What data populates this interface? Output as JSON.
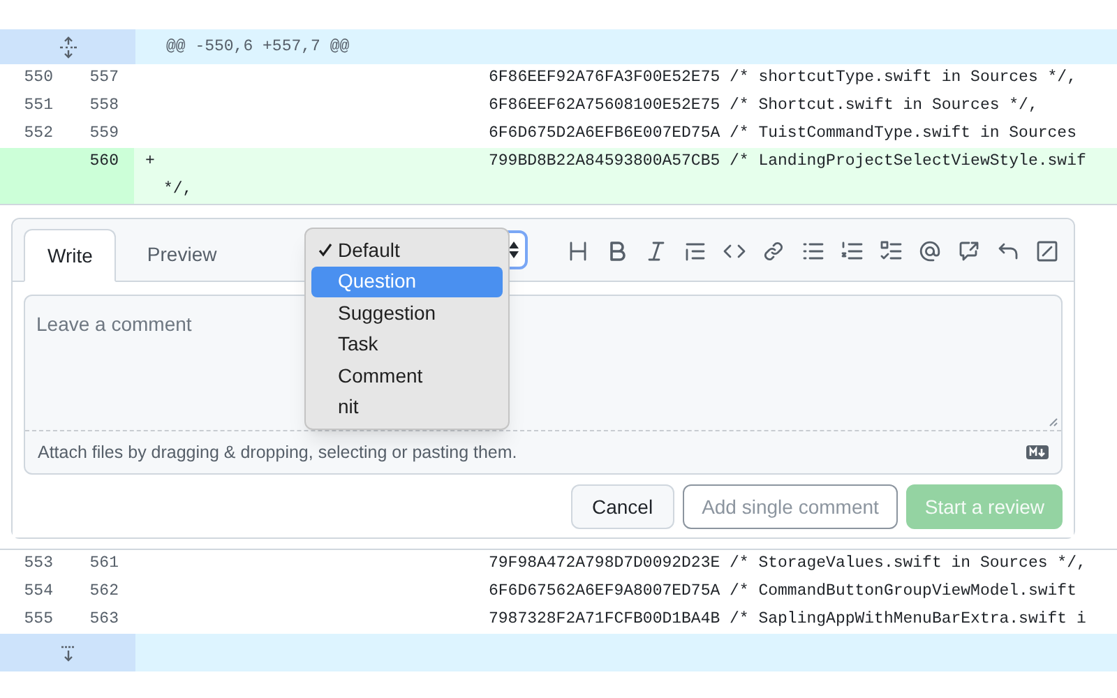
{
  "diff": {
    "hunk_header": "@@ -550,6 +557,7 @@",
    "lines_before": [
      {
        "kind": "context",
        "old": "550",
        "new": "557",
        "code": "6F86EEF92A76FA3F00E52E75 /* shortcutType.swift in Sources */,"
      },
      {
        "kind": "context",
        "old": "551",
        "new": "558",
        "code": "6F86EEF62A75608100E52E75 /* Shortcut.swift in Sources */,"
      },
      {
        "kind": "context",
        "old": "552",
        "new": "559",
        "code": "6F6D675D2A6EFB6E007ED75A /* TuistCommandType.swift in Sources"
      },
      {
        "kind": "added",
        "new": "560",
        "marker": "+",
        "code": "799BD8B22A84593800A57CB5 /* LandingProjectSelectViewStyle.swif",
        "continuation": "*/,"
      }
    ],
    "lines_after": [
      {
        "old": "553",
        "new": "561",
        "code": "79F98A472A798D7D0092D23E /* StorageValues.swift in Sources */,"
      },
      {
        "old": "554",
        "new": "562",
        "code": "6F6D67562A6EF9A8007ED75A /* CommandButtonGroupViewModel.swift"
      },
      {
        "old": "555",
        "new": "563",
        "code": "7987328F2A71FCFB00D1BA4B /* SaplingAppWithMenuBarExtra.swift i"
      }
    ]
  },
  "comment_form": {
    "tabs": [
      {
        "label": "Write",
        "selected": true
      },
      {
        "label": "Preview",
        "selected": false
      }
    ],
    "type_menu": [
      {
        "label": "Default",
        "checked": true,
        "selected": false
      },
      {
        "label": "Question",
        "checked": false,
        "selected": true
      },
      {
        "label": "Suggestion",
        "checked": false,
        "selected": false
      },
      {
        "label": "Task",
        "checked": false,
        "selected": false
      },
      {
        "label": "Comment",
        "checked": false,
        "selected": false
      },
      {
        "label": "nit",
        "checked": false,
        "selected": false
      }
    ],
    "editor": {
      "placeholder": "Leave a comment"
    },
    "attach_hint": "Attach files by dragging & dropping, selecting or pasting them.",
    "buttons": [
      {
        "label": "Cancel",
        "kind": "default",
        "disabled": false
      },
      {
        "label": "Add single comment",
        "kind": "outline",
        "disabled": true
      },
      {
        "label": "Start a review",
        "kind": "primary",
        "disabled": true
      }
    ]
  }
}
